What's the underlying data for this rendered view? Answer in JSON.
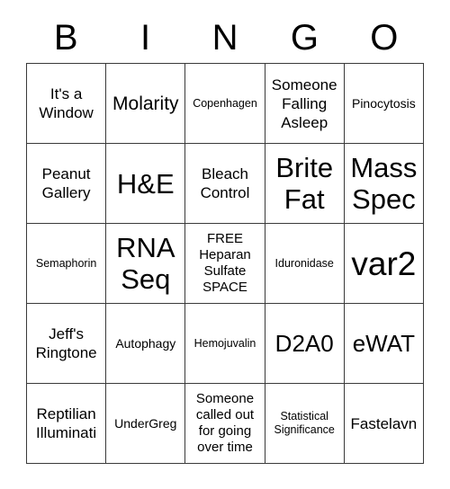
{
  "card": {
    "header_letters": [
      "B",
      "I",
      "N",
      "G",
      "O"
    ],
    "rows": [
      [
        {
          "text": "It's a Window",
          "size": "md"
        },
        {
          "text": "Molarity",
          "size": "lg"
        },
        {
          "text": "Copenhagen",
          "size": "xs"
        },
        {
          "text": "Someone Falling Asleep",
          "size": "md"
        },
        {
          "text": "Pinocytosis",
          "size": "sm"
        }
      ],
      [
        {
          "text": "Peanut Gallery",
          "size": "md"
        },
        {
          "text": "H&E",
          "size": "xxl"
        },
        {
          "text": "Bleach Control",
          "size": "md"
        },
        {
          "text": "Brite Fat",
          "size": "xxl"
        },
        {
          "text": "Mass Spec",
          "size": "xxl"
        }
      ],
      [
        {
          "text": "Semaphorin",
          "size": "xs"
        },
        {
          "text": "RNA Seq",
          "size": "xxl"
        },
        {
          "text": "FREE Heparan Sulfate SPACE",
          "size": "smd"
        },
        {
          "text": "Iduronidase",
          "size": "xs"
        },
        {
          "text": "var2",
          "size": "huge"
        }
      ],
      [
        {
          "text": "Jeff's Ringtone",
          "size": "md"
        },
        {
          "text": "Autophagy",
          "size": "sm"
        },
        {
          "text": "Hemojuvalin",
          "size": "xs"
        },
        {
          "text": "D2A0",
          "size": "xl"
        },
        {
          "text": "eWAT",
          "size": "xl"
        }
      ],
      [
        {
          "text": "Reptilian Illuminati",
          "size": "md"
        },
        {
          "text": "UnderGreg",
          "size": "sm"
        },
        {
          "text": "Someone called out for going over time",
          "size": "smd"
        },
        {
          "text": "Statistical Significance",
          "size": "xs"
        },
        {
          "text": "Fastelavn",
          "size": "md"
        }
      ]
    ]
  },
  "colors": {
    "background": "#ffffff",
    "text": "#000000",
    "grid_line": "#3a3a3a"
  }
}
